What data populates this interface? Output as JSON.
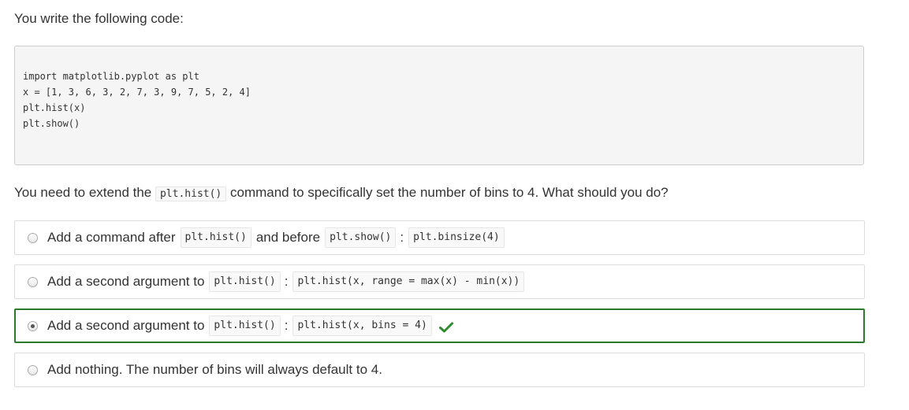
{
  "intro_text": "You write the following code:",
  "code_lines": [
    "import matplotlib.pyplot as plt",
    "x = [1, 3, 6, 3, 2, 7, 3, 9, 7, 5, 2, 4]",
    "plt.hist(x)",
    "plt.show()"
  ],
  "question": {
    "before": "You need to extend the",
    "code": "plt.hist()",
    "after": "command to specifically set the number of bins to 4. What should you do?"
  },
  "options": [
    {
      "text1": "Add a command after",
      "code1": "plt.hist()",
      "text2": "and before",
      "code2": "plt.show()",
      "sep": ":",
      "code3": "plt.binsize(4)",
      "selected": false
    },
    {
      "text1": "Add a second argument to",
      "code1": "plt.hist()",
      "sep": ":",
      "code2": "plt.hist(x, range = max(x) - min(x))",
      "selected": false
    },
    {
      "text1": "Add a second argument to",
      "code1": "plt.hist()",
      "sep": ":",
      "code2": "plt.hist(x, bins = 4)",
      "selected": true,
      "correct": true
    },
    {
      "text1": "Add nothing. The number of bins will always default to 4.",
      "selected": false
    }
  ],
  "icons": {
    "correct_mark": "checkmark-icon"
  },
  "colors": {
    "correct_border": "#2c7a2c",
    "checkmark": "#2e8b2e",
    "code_background": "#f5f5f5"
  }
}
